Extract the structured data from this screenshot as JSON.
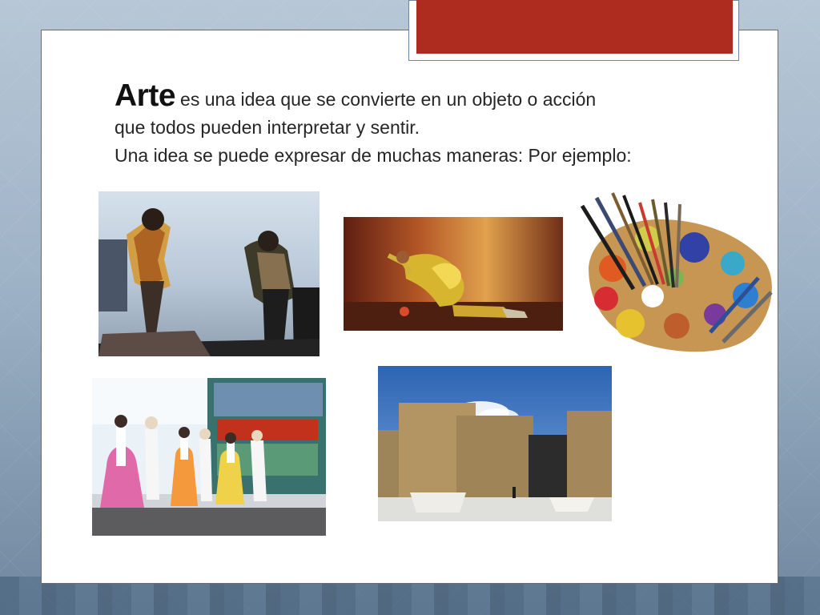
{
  "slide": {
    "lead_word": "Arte",
    "line1_rest": "es una idea que se convierte en un objeto o acción",
    "line2": "que todos pueden interpretar y sentir.",
    "line3": "Una idea se puede expresar de muchas maneras: Por ejemplo:"
  },
  "images": {
    "concert": "concert-photo",
    "dancer": "dancer-photo",
    "palette": "paint-palette-photo",
    "folk_dance": "folk-dance-photo",
    "architecture": "architecture-photo"
  },
  "colors": {
    "title_bar": "#ad2b1f",
    "background": "#9fb3c7"
  }
}
